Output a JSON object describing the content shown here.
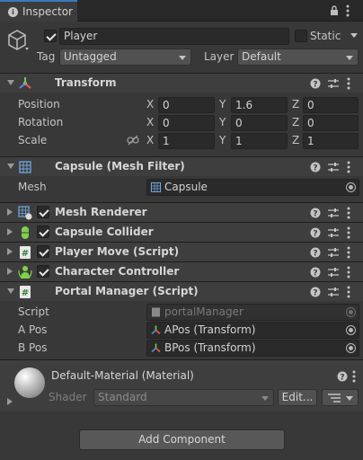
{
  "tab": {
    "label": "Inspector"
  },
  "gameobject": {
    "active": true,
    "name": "Player",
    "static_label": "Static",
    "static_checked": false,
    "tag_label": "Tag",
    "tag_value": "Untagged",
    "layer_label": "Layer",
    "layer_value": "Default"
  },
  "transform": {
    "title": "Transform",
    "rows": [
      {
        "label": "Position",
        "x": "0",
        "y": "1.6",
        "z": "0"
      },
      {
        "label": "Rotation",
        "x": "0",
        "y": "0",
        "z": "0"
      },
      {
        "label": "Scale",
        "x": "1",
        "y": "1",
        "z": "1"
      }
    ],
    "axes": [
      "X",
      "Y",
      "Z"
    ]
  },
  "mesh_filter": {
    "title": "Capsule (Mesh Filter)",
    "mesh_label": "Mesh",
    "mesh_value": "Capsule"
  },
  "components": [
    {
      "title": "Mesh Renderer",
      "enabled": true
    },
    {
      "title": "Capsule Collider",
      "enabled": true
    },
    {
      "title": "Player Move (Script)",
      "enabled": true
    },
    {
      "title": "Character Controller",
      "enabled": true
    }
  ],
  "portal_manager": {
    "title": "Portal Manager (Script)",
    "script_label": "Script",
    "script_value": "portalManager",
    "a_label": "A Pos",
    "a_value": "APos (Transform)",
    "b_label": "B Pos",
    "b_value": "BPos (Transform)"
  },
  "material": {
    "title": "Default-Material (Material)",
    "shader_label": "Shader",
    "shader_value": "Standard",
    "edit_label": "Edit..."
  },
  "add_component_label": "Add Component",
  "colors": {
    "tab_accent": "#3a79bb",
    "panel": "#383838",
    "header": "#3e3e3e"
  }
}
